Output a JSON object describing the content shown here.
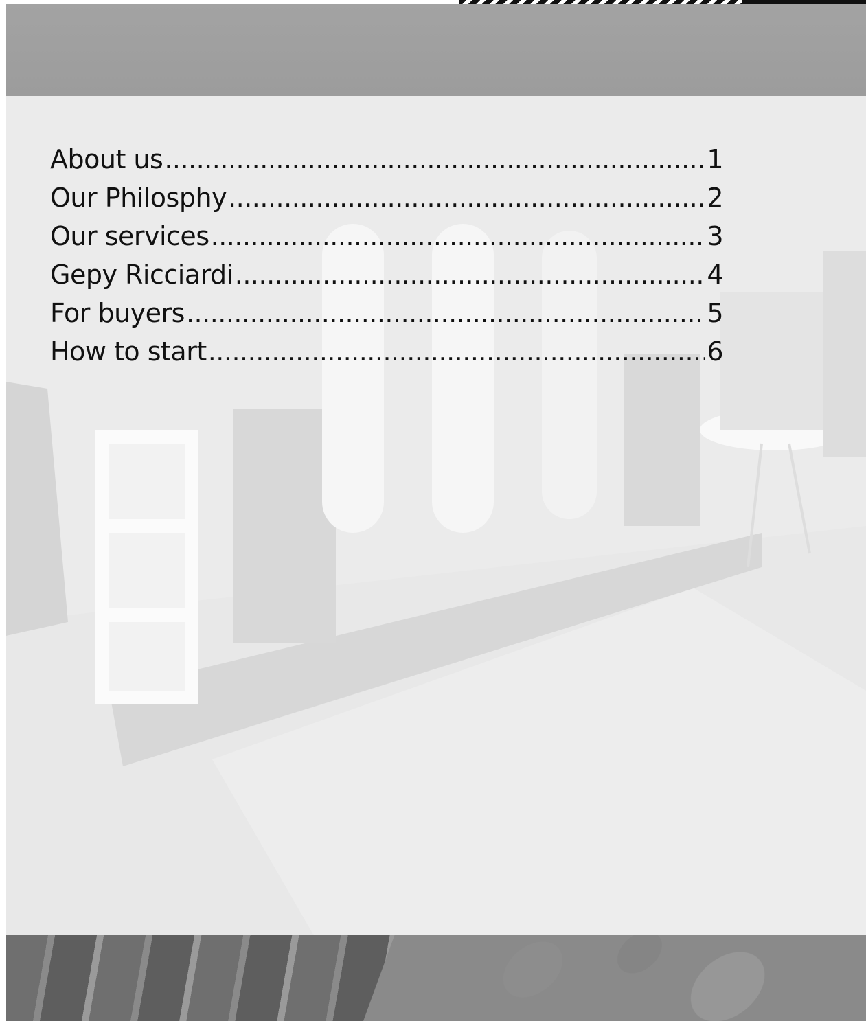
{
  "toc": {
    "items": [
      {
        "label": "About us ",
        "page": "1"
      },
      {
        "label": "Our Philosphy",
        "page": "2"
      },
      {
        "label": "Our services",
        "page": "3"
      },
      {
        "label": "Gepy Ricciardi",
        "page": "4"
      },
      {
        "label": "For buyers",
        "page": "5"
      },
      {
        "label": "How to start",
        "page": "6"
      }
    ]
  }
}
